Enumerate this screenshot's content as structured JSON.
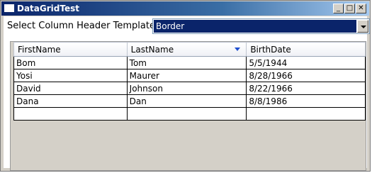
{
  "window": {
    "title": "DataGridTest"
  },
  "header": {
    "label": "Select Column Header Template"
  },
  "combo": {
    "value": "Border"
  },
  "grid": {
    "columns": [
      "FirstName",
      "LastName",
      "BirthDate"
    ],
    "sorted_column": "LastName",
    "rows": [
      [
        "Bom",
        "Tom",
        "5/5/1944"
      ],
      [
        "Yosi",
        "Maurer",
        "8/28/1966"
      ],
      [
        "David",
        "Johnson",
        "8/22/1966"
      ],
      [
        "Dana",
        "Dan",
        "8/8/1986"
      ],
      [
        "",
        "",
        ""
      ]
    ]
  }
}
